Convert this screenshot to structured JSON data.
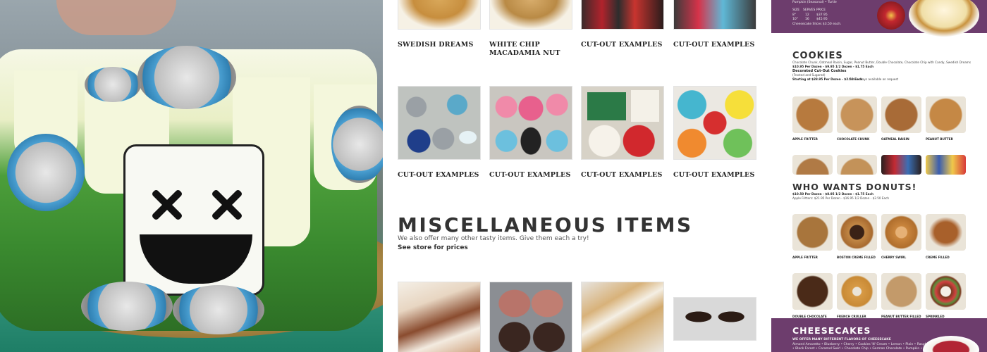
{
  "middle": {
    "row1_captions": [
      "SWEDISH DREAMS",
      "WHITE CHIP MACADAMIA NUT",
      "CUT-OUT EXAMPLES",
      "CUT-OUT EXAMPLES"
    ],
    "row2_captions": [
      "CUT-OUT EXAMPLES",
      "CUT-OUT EXAMPLES",
      "CUT-OUT EXAMPLES",
      "CUT-OUT EXAMPLES"
    ],
    "section_title": "MISCELLANEOUS ITEMS",
    "section_subtitle": "We also offer many other tasty items. Give them each a try!",
    "section_link": "See store for prices"
  },
  "right": {
    "top_band": {
      "line1": "Pumpkin (Seasonal) • Turtle",
      "header_size": "SIZE",
      "header_serves": "SERVES",
      "header_price": "PRICE",
      "row1_size": "8\"",
      "row1_serves": "12",
      "row1_price": "$37.95",
      "row2_size": "10\"",
      "row2_serves": "16",
      "row2_price": "$45.95",
      "note": "Cheesecake Slices $3.50 each."
    },
    "cookies": {
      "title": "COOKIES",
      "flavors": "Chocolate Chunk, Oatmeal Raisin, Sugar, Peanut Butter, Double Chocolate, Chocolate Chip with Candy, Swedish Dreams",
      "price_line": "$10.95 Per Dozen - $9.95 1/2 Dozen - $1.75 Each",
      "decorated_title": "Decorated Cut-Out Cookies",
      "decorated_sub": "(Frosted and Sugared)",
      "decorated_price": "Starting at $28.95 Per Dozen - $2.50 Each",
      "decorated_note": "Cookie trays available on request",
      "labels": [
        "APPLE FRITTER",
        "CHOCOLATE CHUNK",
        "OATMEAL RAISIN",
        "PEANUT BUTTER"
      ]
    },
    "donuts": {
      "title": "WHO WANTS DONUTS!",
      "price_line": "$10.50 Per Dozen - $8.95 1/2 Dozen - $1.75 Each",
      "fritter_line": "Apple Fritters: $21.95 Per Dozen - $16.95 1/2 Dozen - $2.50 Each",
      "row1_labels": [
        "APPLE FRITTER",
        "BOSTON CREME FILLED",
        "CHERRY SWIRL",
        "CREME FILLED"
      ],
      "row2_labels": [
        "DOUBLE CHOCOLATE",
        "FRENCH CRULLER",
        "PEANUT BUTTER FILLED",
        "SPRINKLED"
      ]
    },
    "cheesecakes": {
      "title": "CHEESECAKES",
      "line1": "WE OFFER MANY DIFFERENT FLAVORS OF CHEESECAKE",
      "line2": "Almond Amaretto • Blueberry • Cherry • Cookies 'N' Cream • Lemon • Plain • Raspberry Swirl",
      "line3": "• Black Forest • Caramel Swirl • Chocolate Chip • German Chocolate • Pumpkin • Turtle"
    }
  }
}
